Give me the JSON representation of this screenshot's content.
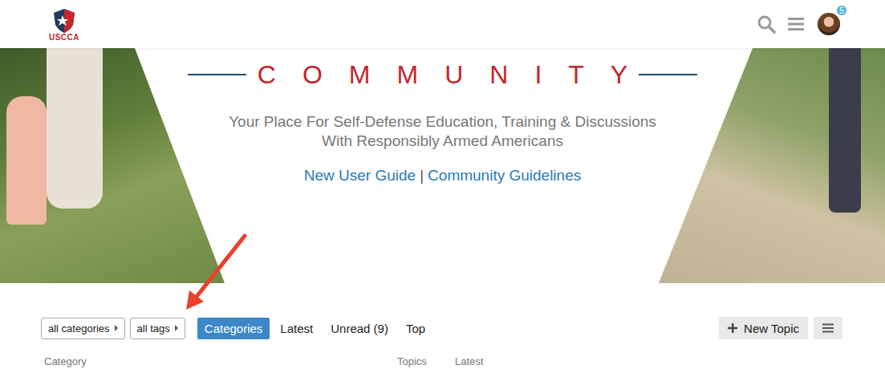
{
  "header": {
    "logo_text": "USCCA",
    "notification_count": "5"
  },
  "hero": {
    "title": "COMMUNITY",
    "subtitle": [
      "Your Place For Self-Defense Education, Training & Discussions",
      "With Responsibly Armed Americans"
    ],
    "links": [
      {
        "label": "New User Guide"
      },
      {
        "label": "Community Guidelines"
      }
    ],
    "separator": "|"
  },
  "nav": {
    "filters": [
      {
        "label": "all categories"
      },
      {
        "label": "all tags"
      }
    ],
    "tabs": [
      {
        "label": "Categories",
        "selected": true
      },
      {
        "label": "Latest",
        "selected": false
      },
      {
        "label": "Unread (9)",
        "selected": false
      },
      {
        "label": "Top",
        "selected": false
      }
    ],
    "new_topic": "New Topic"
  },
  "table": {
    "columns": [
      "Category",
      "Topics",
      "Latest"
    ]
  }
}
